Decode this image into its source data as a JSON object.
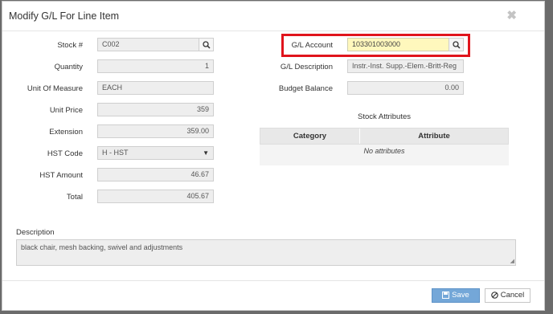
{
  "dialog": {
    "title": "Modify G/L For Line Item",
    "close_glyph": "✖"
  },
  "left": {
    "stock_label": "Stock #",
    "stock_value": "C002",
    "quantity_label": "Quantity",
    "quantity_value": "1",
    "uom_label": "Unit Of Measure",
    "uom_value": "EACH",
    "unit_price_label": "Unit Price",
    "unit_price_value": "359",
    "extension_label": "Extension",
    "extension_value": "359.00",
    "hst_code_label": "HST Code",
    "hst_code_value": "H - HST",
    "hst_amount_label": "HST Amount",
    "hst_amount_value": "46.67",
    "total_label": "Total",
    "total_value": "405.67"
  },
  "right": {
    "gl_account_label": "G/L Account",
    "gl_account_value": "103301003000",
    "gl_desc_label": "G/L Description",
    "gl_desc_value": "Instr.-Inst. Supp.-Elem.-Britt-Reg",
    "budget_label": "Budget Balance",
    "budget_value": "0.00"
  },
  "attributes": {
    "title": "Stock Attributes",
    "columns": [
      "Category",
      "Attribute"
    ],
    "empty_text": "No attributes"
  },
  "description": {
    "label": "Description",
    "value": "black chair, mesh backing, swivel and adjustments"
  },
  "footer": {
    "save_label": "Save",
    "cancel_label": "Cancel"
  },
  "colors": {
    "highlight": "#e0141c",
    "save_button": "#74a7d8",
    "gl_field": "#fff8bd"
  }
}
